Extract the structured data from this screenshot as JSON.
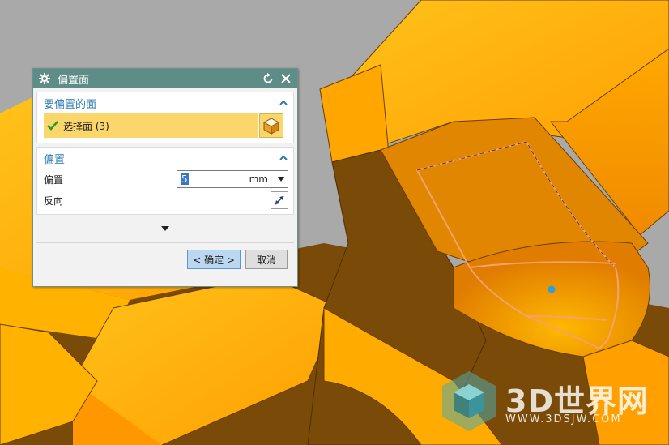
{
  "dialog": {
    "title": "偏置面",
    "title_icon": "gear-icon",
    "faces_group": {
      "title": "要偏置的面",
      "selection_label": "选择面 (3)",
      "select_icon": "cube-select-icon"
    },
    "offset_group": {
      "title": "偏置",
      "offset_label": "偏置",
      "offset_value": "5",
      "offset_unit": "mm",
      "reverse_label": "反向",
      "reverse_icon": "reverse-direction-icon"
    },
    "ok_button": "< 确定 >",
    "cancel_button": "取消"
  },
  "watermark": {
    "brand": "3D世界网",
    "url": "WWW.3DSJW.COM"
  },
  "colors": {
    "titlebar": "#5e8c86",
    "group_header_text": "#2a7ab0",
    "selection_highlight": "#fbd66a",
    "model_light": "#ffb300",
    "model_dark": "#7a4a08",
    "background": "#a9a9a9"
  }
}
